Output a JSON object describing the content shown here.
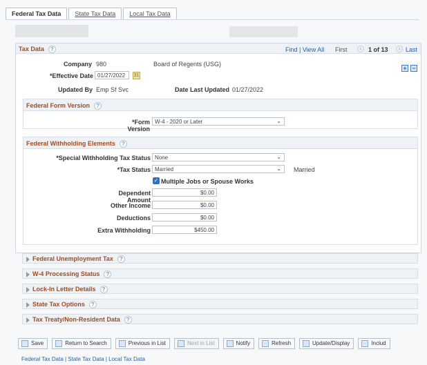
{
  "tabs": [
    {
      "label": "Federal Tax Data"
    },
    {
      "label": "State Tax Data"
    },
    {
      "label": "Local Tax Data"
    }
  ],
  "panel": {
    "title": "Tax Data",
    "find": "Find | View All",
    "first": "First",
    "count": "1 of 13",
    "last": "Last",
    "company_label": "Company",
    "company_value": "980",
    "company_name": "Board of Regents (USG)",
    "effective_label": "*Effective Date",
    "effective_value": "01/27/2022",
    "updated_label": "Updated By",
    "updated_value": "Emp Sf Svc",
    "date_updated_label": "Date Last Updated",
    "date_updated_value": "01/27/2022"
  },
  "form_version": {
    "title": "Federal Form Version",
    "label": "*Form Version",
    "value": "W-4 - 2020 or Later"
  },
  "withholding": {
    "title": "Federal Withholding Elements",
    "special_label": "*Special Withholding Tax Status",
    "special_value": "None",
    "tax_label": "*Tax Status",
    "tax_value": "Married",
    "tax_display": "Married",
    "multiple_label": "Multiple Jobs or Spouse Works",
    "dependent_label": "Dependent Amount",
    "dependent_value": "$0.00",
    "other_label": "Other Income",
    "other_value": "$0.00",
    "deductions_label": "Deductions",
    "deductions_value": "$0.00",
    "extra_label": "Extra Withholding",
    "extra_value": "$450.00"
  },
  "collapsed": [
    {
      "label": "Federal Unemployment Tax"
    },
    {
      "label": "W-4 Processing Status"
    },
    {
      "label": "Lock-In Letter Details"
    },
    {
      "label": "State Tax Options"
    },
    {
      "label": "Tax Treaty/Non-Resident Data"
    }
  ],
  "toolbar": [
    {
      "label": "Save"
    },
    {
      "label": "Return to Search"
    },
    {
      "label": "Previous in List"
    },
    {
      "label": "Next in List"
    },
    {
      "label": "Notify"
    },
    {
      "label": "Refresh"
    },
    {
      "label": "Update/Display"
    },
    {
      "label": "Includ"
    }
  ],
  "footer": "Federal Tax Data | State Tax Data | Local Tax Data",
  "icons": {
    "help": "question-icon",
    "calendar": "calendar-icon",
    "add": "plus-icon",
    "remove": "minus-icon",
    "dropdown": "chevron-down-icon",
    "nav_left": "left-arrow-icon",
    "nav_right": "right-arrow-icon",
    "check": "check-icon",
    "expand": "triangle-right-icon"
  },
  "colors": {
    "section_title": "#a34c1d",
    "link": "#2d5d9a",
    "header_bg": "#eef2f7"
  }
}
